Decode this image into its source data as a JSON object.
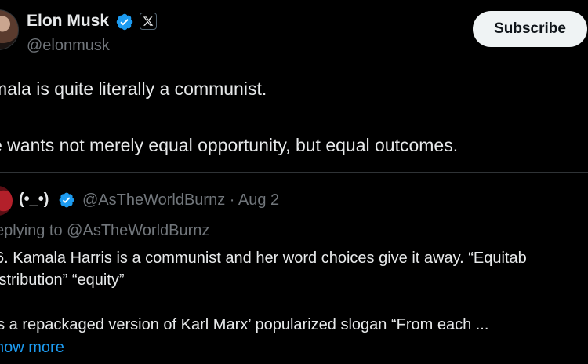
{
  "author": {
    "name": "Elon Musk",
    "handle": "@elonmusk",
    "verified_icon": "verified-badge-icon",
    "affiliate_icon": "x-logo-icon"
  },
  "subscribe_label": "Subscribe",
  "tweet": {
    "line1": "mala is quite literally a communist.",
    "line2": "e wants not merely equal opportunity, but equal outcomes."
  },
  "quoted": {
    "name": "(•_•)",
    "handle_date": "@AsTheWorldBurnz · Aug 2",
    "replying_to": "eplying to @AsTheWorldBurnz",
    "line1": "6. Kamala Harris is a communist and her word choices give it away. “Equitab",
    "line2": "istribution” “equity”",
    "line3": "’s a repackaged version of Karl Marx’ popularized slogan “From each ...",
    "show_more": "how more"
  },
  "colors": {
    "background": "#000000",
    "text": "#e7e9ea",
    "muted": "#71767b",
    "link": "#1d9bf0",
    "verified": "#1d9bf0",
    "button_bg": "#eff3f4"
  }
}
